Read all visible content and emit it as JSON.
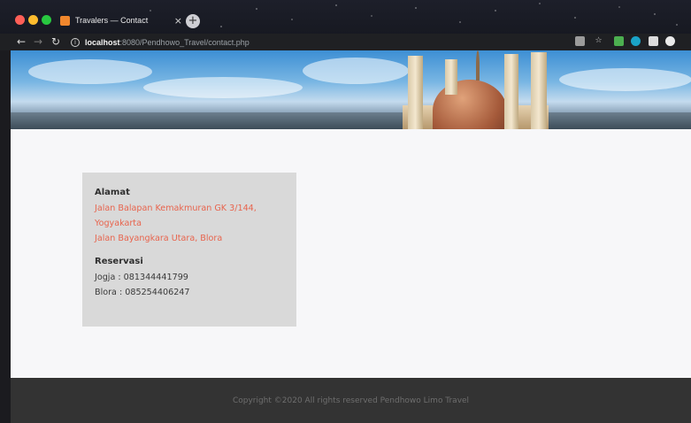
{
  "browser": {
    "tab_title": "Travalers — Contact",
    "tab_close": "×",
    "new_tab": "+",
    "url_host": "localhost",
    "url_path": ":8080/Pendhowo_Travel/contact.php"
  },
  "icons": {
    "back": "←",
    "forward": "→",
    "reload": "↻",
    "info": "i",
    "bookmark": "☆"
  },
  "contact": {
    "alamat_title": "Alamat",
    "alamat_lines": [
      "Jalan Balapan Kemakmuran GK 3/144,",
      "Yogyakarta",
      "Jalan Bayangkara Utara, Blora"
    ],
    "reservasi_title": "Reservasi",
    "reservasi_lines": [
      "Jogja : 081344441799",
      "Blora : 085254406247"
    ]
  },
  "footer": {
    "copyright": "Copyright ©2020 All rights reserved Pendhowo Limo Travel"
  },
  "colors": {
    "accent": "#e8644d",
    "footer_bg": "#333333",
    "card_bg": "#d9d9d9",
    "page_bg": "#f7f7f9"
  }
}
